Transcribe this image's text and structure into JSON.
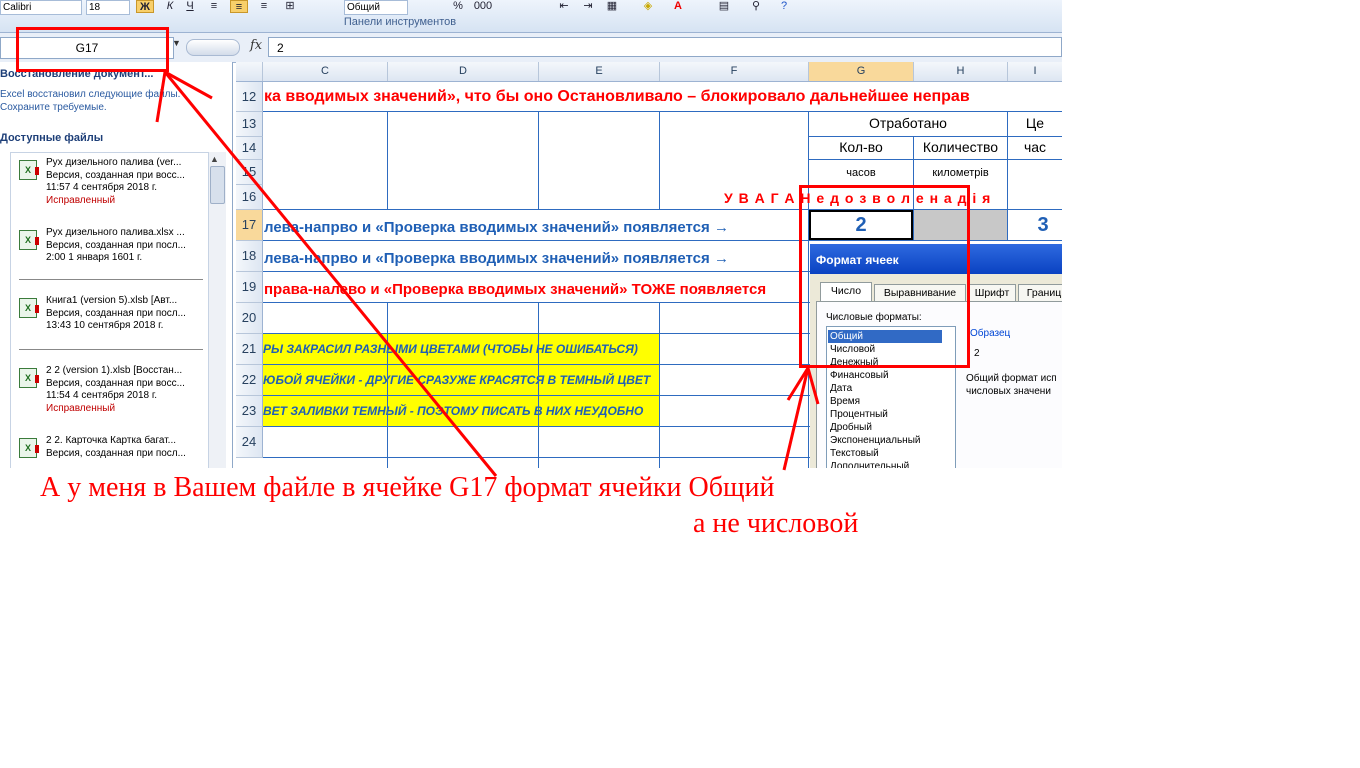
{
  "ribbon": {
    "font_name": "Calibri",
    "font_size": "18",
    "number_format": "Общий",
    "group_label": "Панели инструментов",
    "buttons": [
      "Ж",
      "К",
      "Ч",
      "≡",
      "≡",
      "≡",
      "⊞",
      "%",
      "000"
    ]
  },
  "formula_bar": {
    "name_box": "G17",
    "fx_label": "fx",
    "value": "2"
  },
  "recovery": {
    "title": "Восстановление документ...",
    "intro": "Excel восстановил следующие файлы. Сохраните требуемые.",
    "files_heading": "Доступные файлы",
    "files": [
      {
        "name": "Рух дизельного палива (ver...",
        "line2": "Версия, созданная при восс...",
        "line3": "11:57 4 сентября 2018 г.",
        "status": "Исправленный"
      },
      {
        "name": "Рух дизельного палива.xlsx ...",
        "line2": "Версия, созданная при посл...",
        "line3": "2:00 1 января 1601 г.",
        "status": ""
      },
      {
        "name": "Книга1 (version 5).xlsb  [Авт...",
        "line2": "Версия, созданная при посл...",
        "line3": "13:43 10 сентября 2018 г.",
        "status": ""
      },
      {
        "name": "2 2 (version 1).xlsb  [Восстан...",
        "line2": "Версия, созданная при восс...",
        "line3": "11:54 4 сентября 2018 г.",
        "status": "Исправленный"
      },
      {
        "name": "2 2. Карточка Картка багат...",
        "line2": "Версия, созданная при посл...",
        "line3": "",
        "status": ""
      }
    ]
  },
  "sheet": {
    "columns": [
      "C",
      "D",
      "E",
      "F",
      "G",
      "H",
      "I"
    ],
    "rows": [
      "12",
      "13",
      "14",
      "15",
      "16",
      "17",
      "18",
      "19",
      "20",
      "21",
      "22",
      "23",
      "24"
    ],
    "r12": "ка вводимых значений», что бы оно Остановливало – блокировало дальнейшее неправ",
    "r13_g": "Отработано",
    "r13_i": "Це",
    "r14_g": "Кол-во",
    "r14_h": "Количество",
    "r14_i": "час",
    "r15_g": "часов",
    "r15_h": "километрів",
    "r16": "У В А Г А   Н е д о з в о л е н а   д і я",
    "r17": "лева-напрво и «Проверка вводимых значений» появляется →",
    "r17_g": "2",
    "r17_i": "3",
    "r18": "лева-напрво и «Проверка вводимых значений» появляется →",
    "r19": "права-налево и «Проверка вводимых значений» ТОЖЕ появляется",
    "r21": "РЫ ЗАКРАСИЛ РАЗНЫМИ ЦВЕТАМИ (ЧТОБЫ НЕ ОШИБАТЬСЯ)",
    "r22": "ЮБОЙ ЯЧЕЙКИ - ДРУГИЕ СРАЗУЖЕ КРАСЯТСЯ В ТЕМНЫЙ ЦВЕТ",
    "r23": "ВЕТ ЗАЛИВКИ ТЕМНЫЙ - ПОЭТОМУ ПИСАТЬ В НИХ НЕУДОБНО"
  },
  "dialog": {
    "title": "Формат ячеек",
    "tabs": [
      "Число",
      "Выравнивание",
      "Шрифт",
      "Границ"
    ],
    "formats_label": "Числовые форматы:",
    "formats": [
      "Общий",
      "Числовой",
      "Денежный",
      "Финансовый",
      "Дата",
      "Время",
      "Процентный",
      "Дробный",
      "Экспоненциальный",
      "Текстовый",
      "Дополнительный"
    ],
    "selected_format": "Общий",
    "sample_label": "Образец",
    "sample_value": "2",
    "description_1": "Общий формат исп",
    "description_2": "числовых значени"
  },
  "annotation": {
    "line1": "А у меня в Вашем файле в ячейке G17 формат ячейки Общий",
    "line2": "а не числовой"
  }
}
